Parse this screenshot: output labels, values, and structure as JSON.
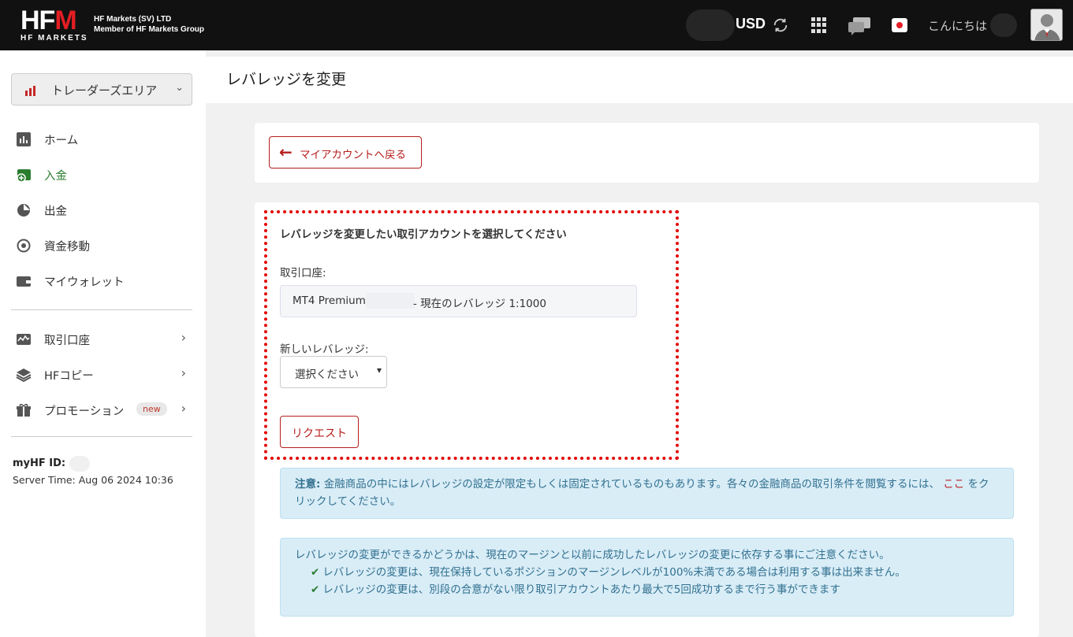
{
  "header": {
    "logo_text": "HFM",
    "logo_sub": "HF MARKETS",
    "company_line1": "HF Markets (SV) LTD",
    "company_line2": "Member of HF Markets Group",
    "currency": "USD",
    "greeting": "こんにちは"
  },
  "sidebar": {
    "area_label": "トレーダーズエリア",
    "items": [
      {
        "label": "ホーム"
      },
      {
        "label": "入金"
      },
      {
        "label": "出金"
      },
      {
        "label": "資金移動"
      },
      {
        "label": "マイウォレット"
      },
      {
        "label": "取引口座"
      },
      {
        "label": "HFコピー"
      },
      {
        "label": "プロモーション",
        "badge": "new"
      }
    ],
    "myhf_label": "myHF ID:",
    "server_time": "Server Time: Aug 06 2024 10:36"
  },
  "page": {
    "title": "レバレッジを変更",
    "back_label": "マイアカウントへ戻る",
    "form_title": "レバレッジを変更したい取引アカウントを選択してください",
    "account_label": "取引口座:",
    "account_prefix": "MT4 Premium:",
    "account_suffix": "- 現在のレバレッジ 1:1000",
    "new_leverage_label": "新しいレバレッジ:",
    "select_value": "選択ください",
    "request_label": "リクエスト"
  },
  "notes": {
    "note1_bold": "注意:",
    "note1_text": "金融商品の中にはレバレッジの設定が限定もしくは固定されているものもあります。各々の金融商品の取引条件を閲覧するには、",
    "note1_link": "ここ",
    "note1_after": "をクリックしてください。",
    "note2_intro": "レバレッジの変更ができるかどうかは、現在のマージンと以前に成功したレバレッジの変更に依存する事にご注意ください。",
    "note2_items": [
      "レバレッジの変更は、現在保持しているポジションのマージンレベルが100%未満である場合は利用する事は出来ません。",
      "レバレッジの変更は、別段の合意がない限り取引アカウントあたり最大で5回成功するまで行う事ができます"
    ]
  },
  "colors": {
    "brand_red": "#b71c1c",
    "topbar": "#111111",
    "info_bg": "#d9edf7",
    "highlight": "#e30000"
  }
}
